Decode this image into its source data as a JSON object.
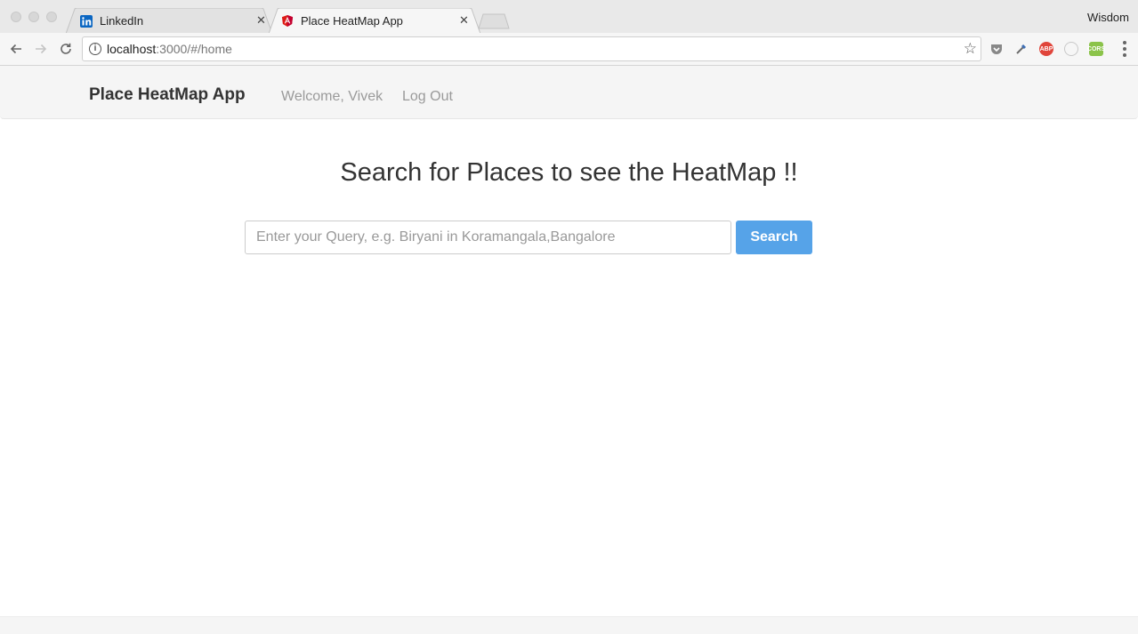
{
  "browser": {
    "user_name": "Wisdom",
    "tabs": [
      {
        "title": "LinkedIn",
        "favicon": "linkedin-icon",
        "active": false
      },
      {
        "title": "Place HeatMap App",
        "favicon": "angular-icon",
        "active": true
      }
    ],
    "url_host": "localhost",
    "url_path": ":3000/#/home",
    "extensions": [
      "pocket-icon",
      "eyedropper-icon",
      "adblock-plus-icon",
      "circle-extension-icon",
      "cors-icon"
    ],
    "extension_labels": {
      "abp": "ABP",
      "cors": "CORS"
    }
  },
  "app": {
    "brand": "Place HeatMap App",
    "nav": {
      "welcome": "Welcome, Vivek",
      "logout": "Log Out"
    },
    "heading": "Search for Places to see the HeatMap !!",
    "search": {
      "placeholder": "Enter your Query, e.g. Biryani in Koramangala,Bangalore",
      "value": "",
      "button_label": "Search"
    }
  },
  "colors": {
    "primary_button": "#56a3e8",
    "navbar_bg": "#f5f5f5",
    "linkedin_blue": "#0a66c2",
    "angular_red": "#dd1b16",
    "abp_red": "#e0453b",
    "cors_green": "#8bc34a"
  }
}
